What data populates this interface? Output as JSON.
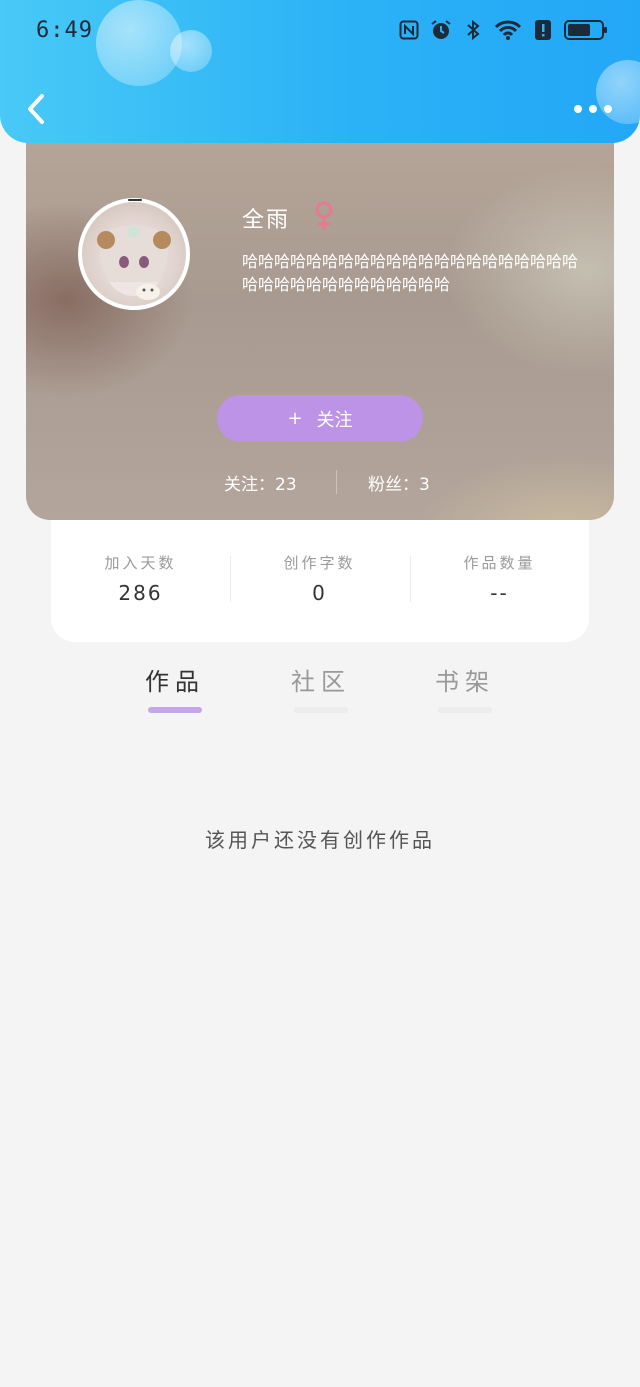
{
  "status_bar": {
    "time": "6:49"
  },
  "header": {
    "back_icon": "chevron-left-icon",
    "more_icon": "more-dots-icon"
  },
  "profile": {
    "name": "全雨",
    "gender_icon": "female-icon",
    "bio": "哈哈哈哈哈哈哈哈哈哈哈哈哈哈哈哈哈哈哈哈哈哈哈哈哈哈哈哈哈哈哈哈哈哈",
    "follow_plus": "+",
    "follow_label": "关注",
    "following_text": "关注：23",
    "fans_text": "粉丝：3",
    "follow_color": "#bc93e6"
  },
  "stats": [
    {
      "label": "加入天数",
      "value": "286"
    },
    {
      "label": "创作字数",
      "value": "0"
    },
    {
      "label": "作品数量",
      "value": "--"
    }
  ],
  "tabs": [
    {
      "label": "作品"
    },
    {
      "label": "社区"
    },
    {
      "label": "书架"
    }
  ],
  "empty_message": "该用户还没有创作作品",
  "colors": {
    "header_blue": "#2bb2f6",
    "tab_indicator": "#c5a6e8"
  }
}
